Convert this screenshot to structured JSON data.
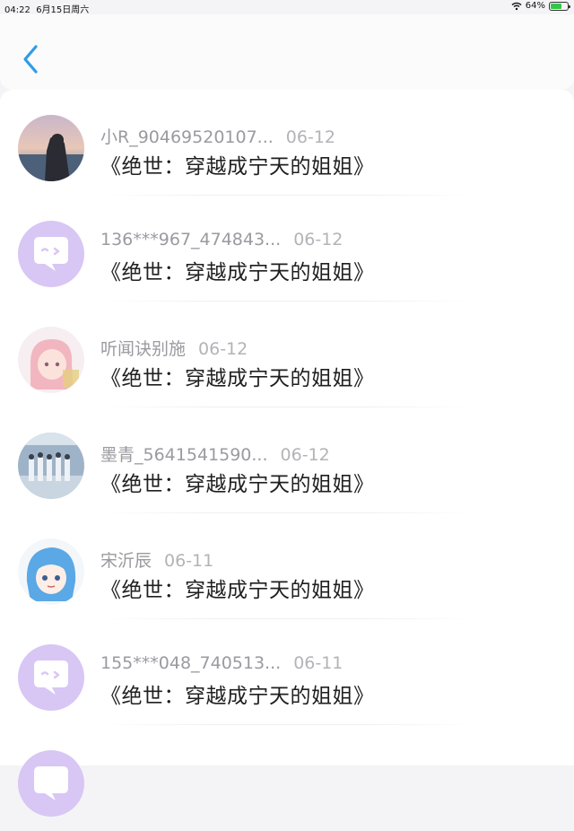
{
  "status_bar": {
    "time": "04:22",
    "date": "6月15日周六",
    "battery": "64%",
    "battery_level": 0.64
  },
  "nav": {
    "back_icon": "chevron-left-icon",
    "accent": "#2f9be8"
  },
  "items": [
    {
      "name": "小R_90469520107...",
      "date": "06-12",
      "title": "《绝世：穿越成宁天的姐姐》",
      "avatar": "photo-girl-sunset"
    },
    {
      "name": "136***967_474843...",
      "date": "06-12",
      "title": "《绝世：穿越成宁天的姐姐》",
      "avatar": "default-chat-bubble"
    },
    {
      "name": "听闻诀别施",
      "date": "06-12",
      "title": "《绝世：穿越成宁天的姐姐》",
      "avatar": "anime-pink-girl"
    },
    {
      "name": "墨青_5641541590...",
      "date": "06-12",
      "title": "《绝世：穿越成宁天的姐姐》",
      "avatar": "photo-group"
    },
    {
      "name": "宋沂辰",
      "date": "06-11",
      "title": "《绝世：穿越成宁天的姐姐》",
      "avatar": "anime-blue-girl"
    },
    {
      "name": "155***048_740513...",
      "date": "06-11",
      "title": "《绝世：穿越成宁天的姐姐》",
      "avatar": "default-chat-bubble"
    },
    {
      "name": "",
      "date": "",
      "title": "",
      "avatar": "default-chat-bubble"
    }
  ]
}
